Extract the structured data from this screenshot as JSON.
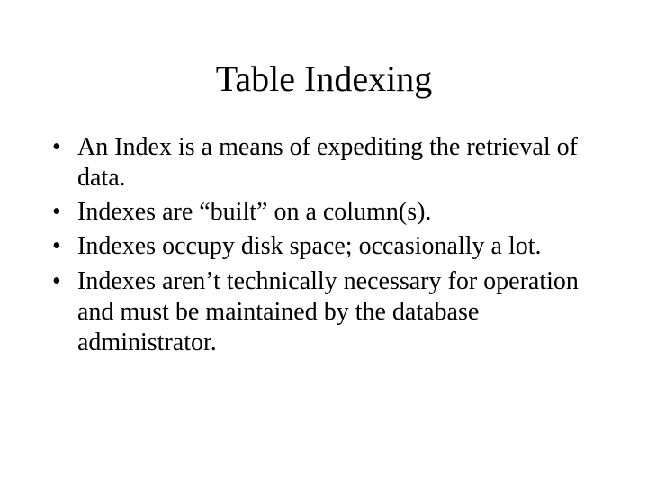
{
  "slide": {
    "title": "Table Indexing",
    "bullets": [
      "An Index is a means of expediting the retrieval of data.",
      "Indexes are “built” on a column(s).",
      "Indexes occupy disk space; occasionally a lot.",
      "Indexes aren’t technically necessary for operation and must be maintained by the database administrator."
    ]
  }
}
